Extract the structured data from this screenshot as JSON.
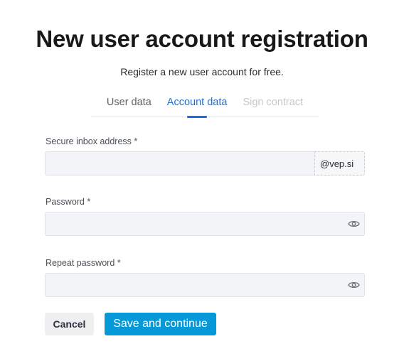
{
  "header": {
    "title": "New user account registration",
    "subtitle": "Register a new user account for free."
  },
  "tabs": [
    {
      "label": "User data",
      "state": "done"
    },
    {
      "label": "Account data",
      "state": "active"
    },
    {
      "label": "Sign contract",
      "state": "disabled"
    }
  ],
  "form": {
    "inbox": {
      "label": "Secure inbox address *",
      "value": "",
      "placeholder": "",
      "suffix": "@vep.si"
    },
    "password": {
      "label": "Password *",
      "value": "",
      "placeholder": "",
      "toggle_icon": "eye-icon"
    },
    "repeat_password": {
      "label": "Repeat password *",
      "value": "",
      "placeholder": "",
      "toggle_icon": "eye-icon"
    }
  },
  "actions": {
    "cancel_label": "Cancel",
    "save_label": "Save and continue"
  },
  "colors": {
    "accent": "#1f6fe0",
    "primary_button": "#0599d8",
    "input_bg": "#f3f4f7"
  }
}
